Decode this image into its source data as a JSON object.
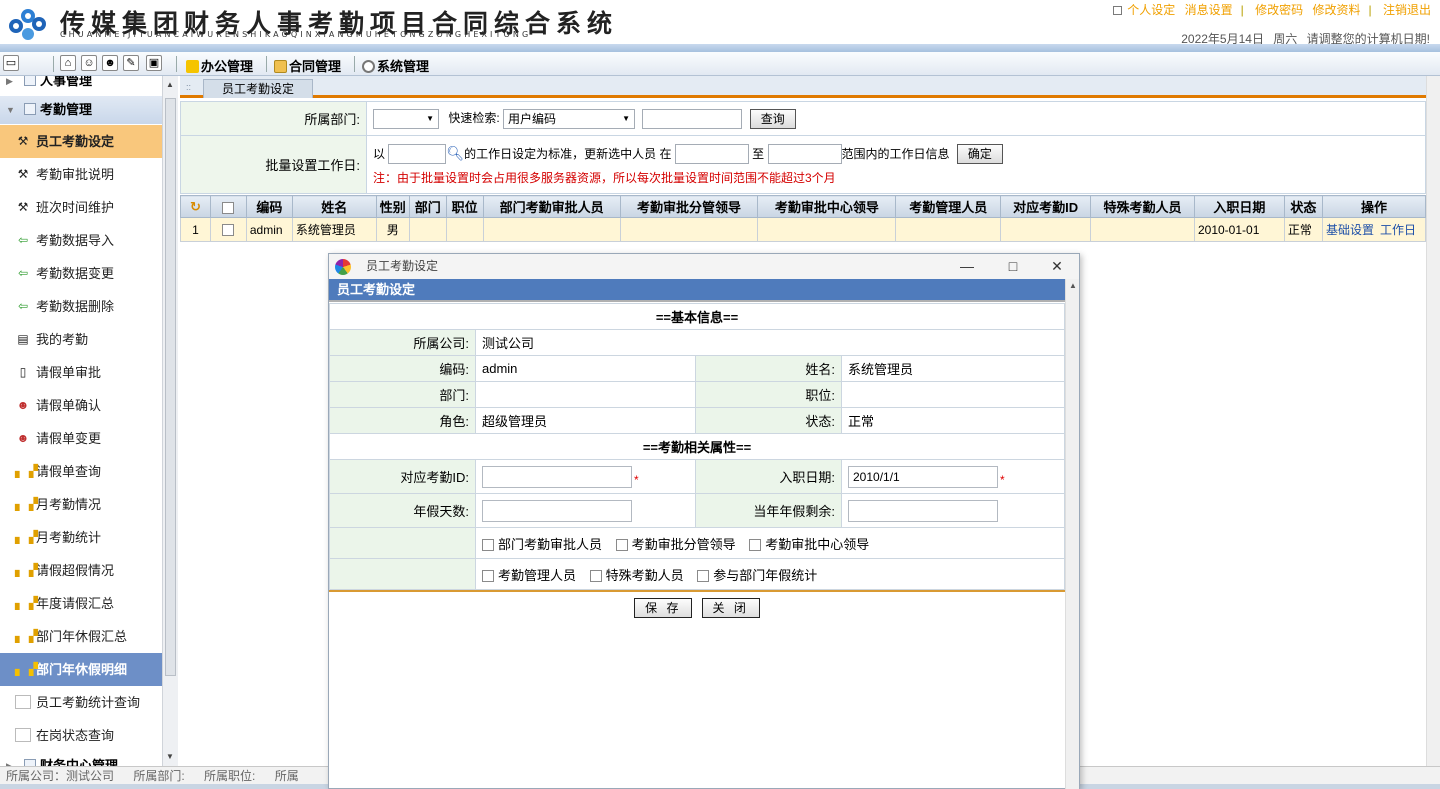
{
  "header": {
    "title": "传媒集团财务人事考勤项目合同综合系统",
    "pinyin": "CHUANMEIJITUANCAIWURENSHIKAOQINXIANGMUHETONGZONGHEXITONG",
    "links": [
      "个人设定",
      "消息设置",
      "修改密码",
      "修改资料",
      "注销退出"
    ],
    "date": "2022年5月14日",
    "weekday": "周六",
    "date_notice": "请调整您的计算机日期!"
  },
  "toolbar": {
    "menus": [
      "办公管理",
      "合同管理",
      "系统管理"
    ]
  },
  "nav": {
    "group_top": "人事管理",
    "group_attendance": "考勤管理",
    "group_bottom": "财务中心管理",
    "items": [
      "员工考勤设定",
      "考勤审批说明",
      "班次时间维护",
      "考勤数据导入",
      "考勤数据变更",
      "考勤数据删除",
      "我的考勤",
      "请假单审批",
      "请假单确认",
      "请假单变更",
      "请假单查询",
      "月考勤情况",
      "月考勤统计",
      "请假超假情况",
      "年度请假汇总",
      "部门年休假汇总",
      "部门年休假明细",
      "员工考勤统计查询",
      "在岗状态查询"
    ]
  },
  "main": {
    "tab_label": "员工考勤设定",
    "filter": {
      "dept_label": "所属部门:",
      "dept_value": "",
      "quick_label": "快速检索:",
      "quick_value": "用户编码",
      "search_value": "",
      "query_button": "查询"
    },
    "batch": {
      "label": "批量设置工作日:",
      "prefix": "以",
      "mid": "的工作日设定为标准，更新选中人员 在",
      "to": "至",
      "suffix": "范围内的工作日信息",
      "confirm_button": "确定",
      "note": "注：由于批量设置时会占用很多服务器资源，所以每次批量设置时间范围不能超过3个月"
    },
    "grid": {
      "columns": [
        "编码",
        "姓名",
        "性别",
        "部门",
        "职位",
        "部门考勤审批人员",
        "考勤审批分管领导",
        "考勤审批中心领导",
        "考勤管理人员",
        "对应考勤ID",
        "特殊考勤人员",
        "入职日期",
        "状态",
        "操作"
      ],
      "rows": [
        {
          "index": "1",
          "code": "admin",
          "name": "系统管理员",
          "gender": "男",
          "dept": "",
          "position": "",
          "approver": "",
          "leader": "",
          "center_leader": "",
          "manager": "",
          "att_id": "",
          "special": "",
          "hire_date": "2010-01-01",
          "status": "正常",
          "actions": [
            "基础设置",
            "工作日"
          ]
        }
      ]
    }
  },
  "statusbar": {
    "company": "所属公司：测试公司",
    "dept": "所属部门:",
    "position": "所属职位:",
    "other": "所属"
  },
  "dialog": {
    "window_title": "员工考勤设定",
    "header": "员工考勤设定",
    "section_basic": "==基本信息==",
    "section_attendance": "==考勤相关属性==",
    "company_label": "所属公司:",
    "company_value": "测试公司",
    "code_label": "编码:",
    "code_value": "admin",
    "name_label": "姓名:",
    "name_value": "系统管理员",
    "dept_label": "部门:",
    "dept_value": "",
    "position_label": "职位:",
    "position_value": "",
    "role_label": "角色:",
    "role_value": "超级管理员",
    "state_label": "状态:",
    "state_value": "正常",
    "att_id_label": "对应考勤ID:",
    "att_id_value": "",
    "hire_label": "入职日期:",
    "hire_value": "2010/1/1",
    "annual_label": "年假天数:",
    "annual_value": "",
    "remain_label": "当年年假剩余:",
    "remain_value": "",
    "required_mark": "*",
    "checks_row1": [
      "部门考勤审批人员",
      "考勤审批分管领导",
      "考勤审批中心领导"
    ],
    "checks_row2": [
      "考勤管理人员",
      "特殊考勤人员",
      "参与部门年假统计"
    ],
    "save_button": "保 存",
    "close_button": "关 闭"
  }
}
